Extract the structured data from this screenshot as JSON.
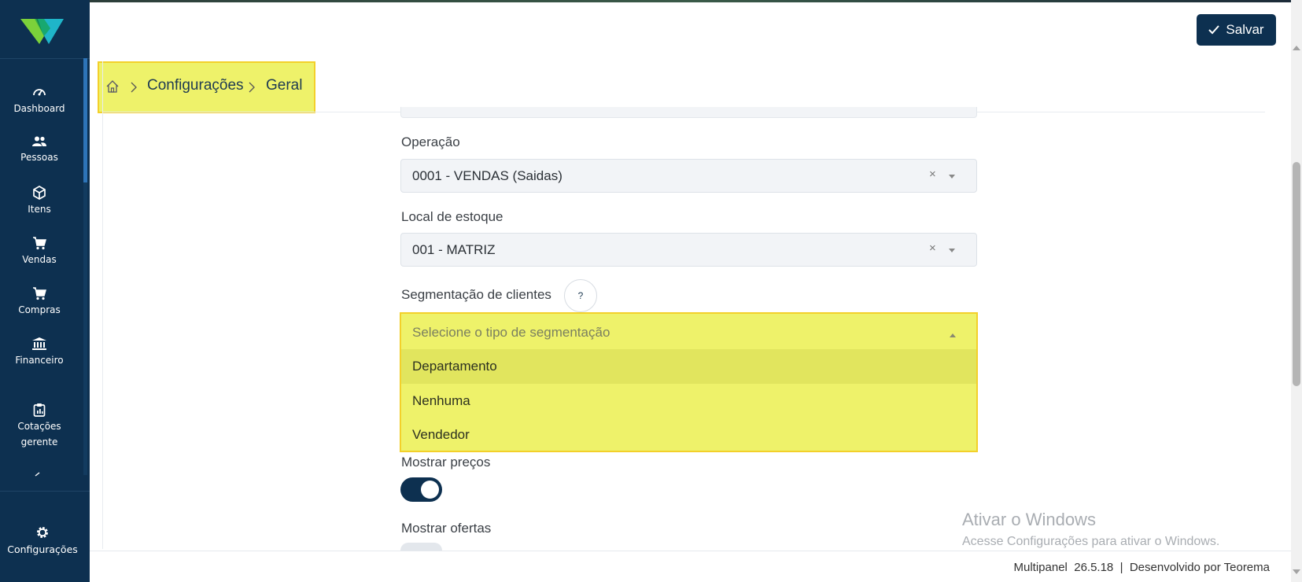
{
  "sidebar": {
    "items": [
      {
        "label": "Dashboard",
        "icon": "dashboard-gauge-icon"
      },
      {
        "label": "Pessoas",
        "icon": "people-icon"
      },
      {
        "label": "Itens",
        "icon": "box-icon"
      },
      {
        "label": "Vendas",
        "icon": "cart-icon"
      },
      {
        "label": "Compras",
        "icon": "cart-icon"
      },
      {
        "label": "Financeiro",
        "icon": "bank-icon"
      },
      {
        "label_line1": "Cotações",
        "label_line2": "gerente",
        "icon": "clipboard-icon"
      }
    ],
    "settings": {
      "label": "Configurações",
      "icon": "gear-icon"
    }
  },
  "toolbar": {
    "save_label": "Salvar"
  },
  "breadcrumb": {
    "item1": "Configurações",
    "item2": "Geral"
  },
  "form": {
    "operacao": {
      "label": "Operação",
      "value": "0001 - VENDAS (Saidas)",
      "clear": "×"
    },
    "local_estoque": {
      "label": "Local de estoque",
      "value": "001 - MATRIZ",
      "clear": "×"
    },
    "segmentacao": {
      "label": "Segmentação de clientes",
      "help": "?",
      "placeholder": "Selecione o tipo de segmentação",
      "options": [
        "Departamento",
        "Nenhuma",
        "Vendedor"
      ],
      "highlighted_option": "Departamento"
    },
    "mostrar_precos": {
      "label": "Mostrar preços",
      "enabled": true
    },
    "mostrar_ofertas": {
      "label": "Mostrar ofertas",
      "enabled": false
    }
  },
  "watermark": {
    "line1": "Ativar o Windows",
    "line2": "Acesse Configurações para ativar o Windows."
  },
  "footer": {
    "text": "Multipanel  26.5.18  |  Desenvolvido por Teorema"
  },
  "colors": {
    "primary": "#0d3050",
    "highlight": "#eef26a",
    "highlight_border": "#f3d02a",
    "logo_green": "#7bd13a",
    "logo_teal": "#1fb5c9"
  }
}
